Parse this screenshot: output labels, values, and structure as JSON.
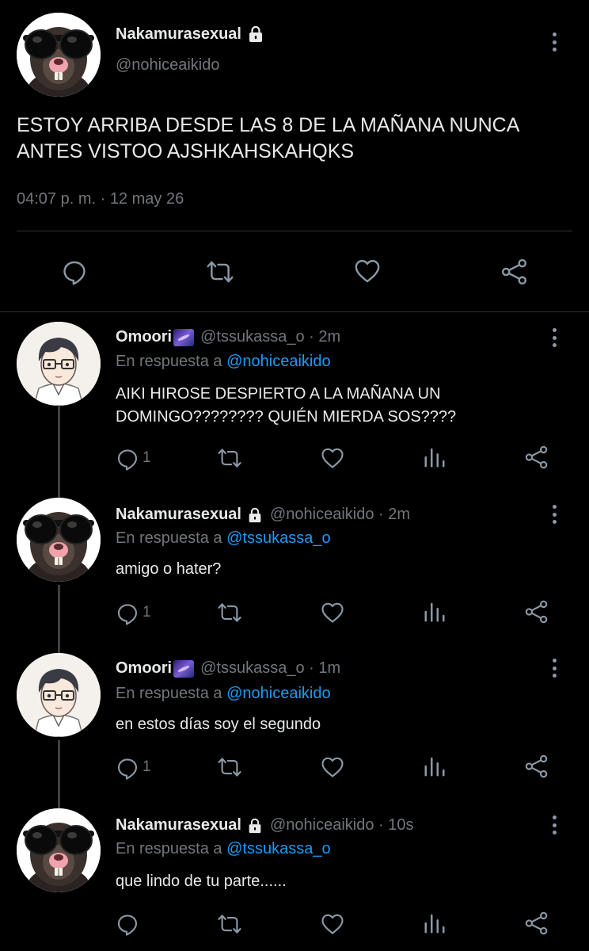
{
  "main_tweet": {
    "name": "Nakamurasexual",
    "handle": "@nohiceaikido",
    "text": "ESTOY ARRIBA DESDE LAS 8 DE LA MAÑANA NUNCA ANTES VISTOO AJSHKAHSKAHQKS",
    "timestamp": "04:07 p. m. · 12 may 26",
    "avatar": "rat-with-sunglasses",
    "locked_icon": "lock-icon",
    "actions": [
      "reply-icon",
      "retweet-icon",
      "like-icon",
      "share-icon"
    ]
  },
  "replies": [
    {
      "name": "Omoori",
      "emoji": "galaxy-emoji",
      "handle": "@tssukassa_o · 2m",
      "reply_prefix": "En respuesta a",
      "reply_to": "@nohiceaikido",
      "text": "AIKI HIROSE DESPIERTO A LA MAÑANA UN DOMINGO???????? QUIÉN MIERDA SOS????",
      "reply_count": "1",
      "avatar": "anime-boy-with-glasses"
    },
    {
      "name": "Nakamurasexual",
      "handle": "@nohiceaikido · 2m",
      "reply_prefix": "En respuesta a",
      "reply_to": "@tssukassa_o",
      "text": "amigo o hater?",
      "reply_count": "1",
      "avatar": "rat-with-sunglasses"
    },
    {
      "name": "Omoori",
      "emoji": "galaxy-emoji",
      "handle": "@tssukassa_o · 1m",
      "reply_prefix": "En respuesta a",
      "reply_to": "@nohiceaikido",
      "text": "en estos días soy el segundo",
      "reply_count": "1",
      "avatar": "anime-boy-with-glasses"
    },
    {
      "name": "Nakamurasexual",
      "handle": "@nohiceaikido · 10s",
      "reply_prefix": "En respuesta a",
      "reply_to": "@tssukassa_o",
      "text": "que lindo de tu parte......",
      "reply_count": "",
      "avatar": "rat-with-sunglasses"
    }
  ],
  "colors": {
    "background": "#000000",
    "text": "#e7e9ea",
    "secondary": "#71767b",
    "accent": "#1d9bf0",
    "divider": "#2f3336"
  }
}
